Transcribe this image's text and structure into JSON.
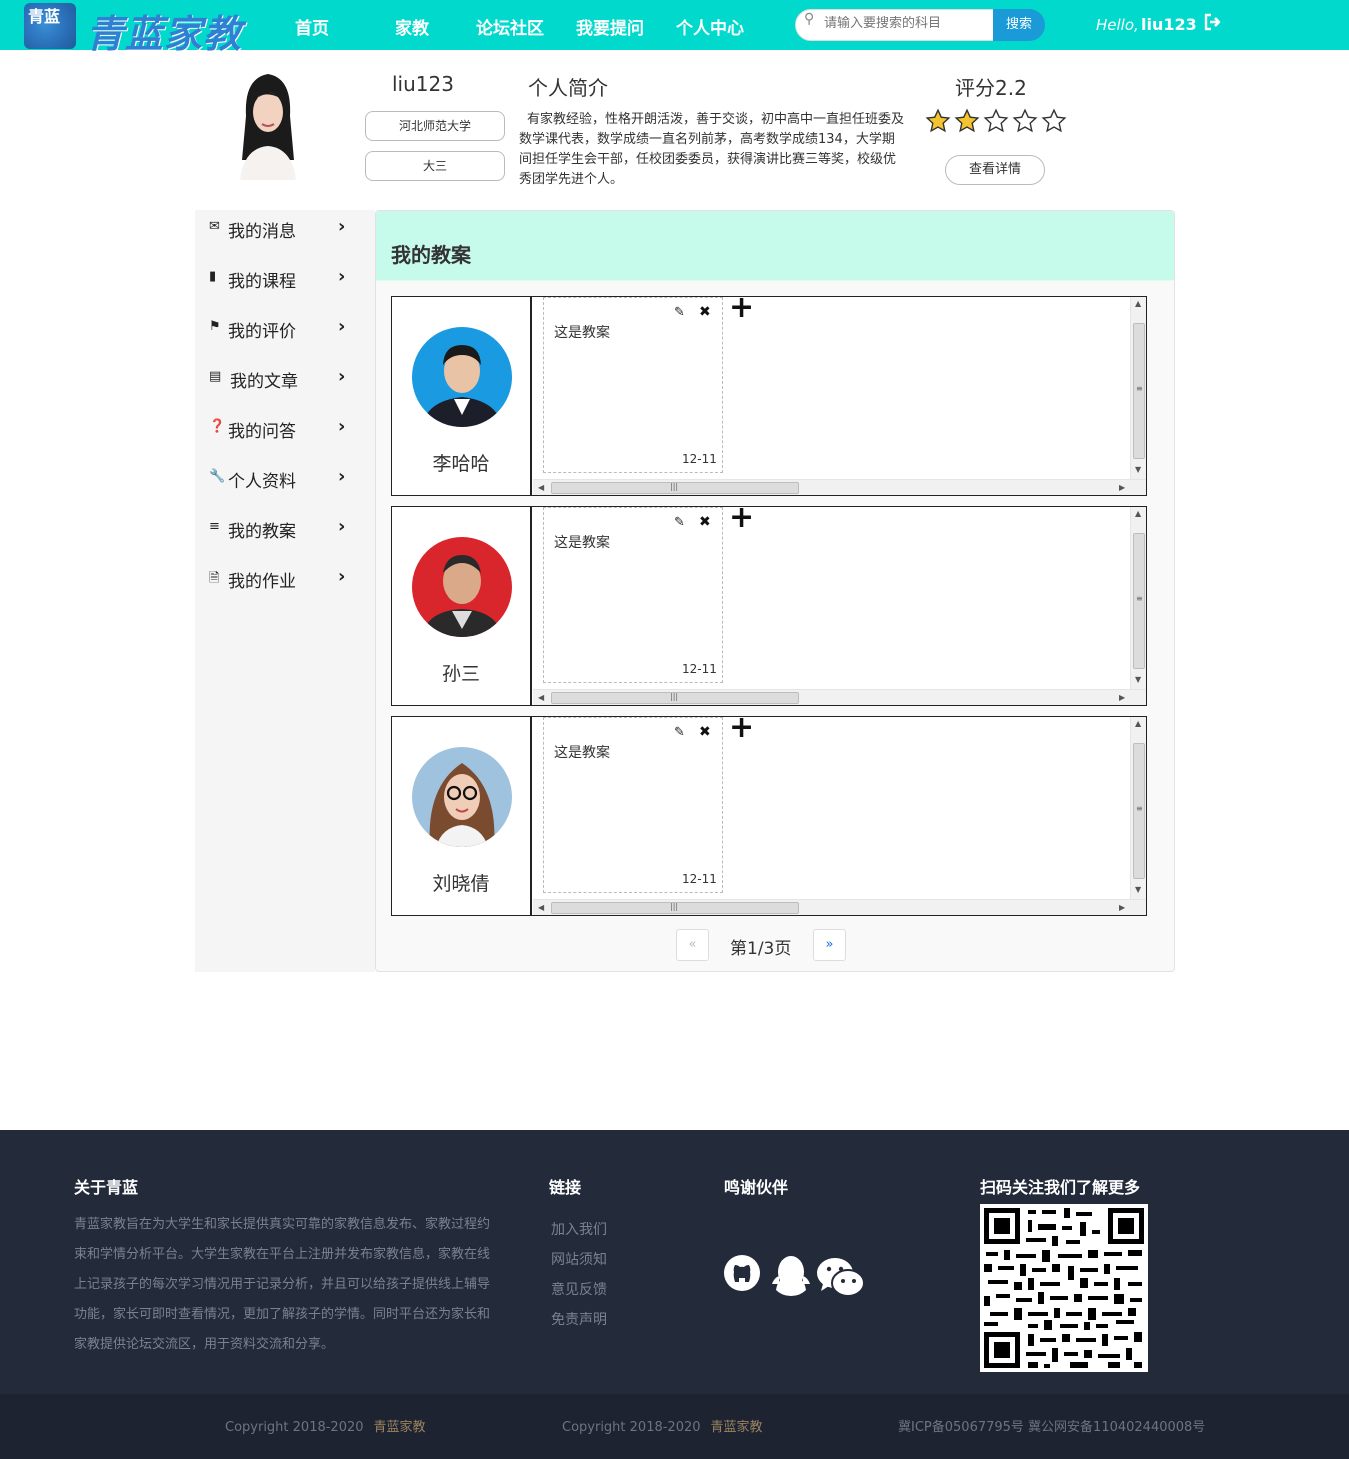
{
  "header": {
    "logo_mark": "青蓝",
    "logo_text": "青蓝家教",
    "nav": [
      "首页",
      "家教",
      "论坛社区",
      "我要提问",
      "个人中心"
    ],
    "search_placeholder": "请输入要搜索的科目",
    "search_button": "搜索",
    "hello": "Hello,",
    "username": "liu123"
  },
  "profile": {
    "name": "liu123",
    "school": "河北师范大学",
    "grade": "大三",
    "intro_title": "个人简介",
    "intro_text": "有家教经验，性格开朗活泼，善于交谈，初中高中一直担任班委及数学课代表，数学成绩一直名列前茅，高考数学成绩134，大学期间担任学生会干部，任校团委委员，获得演讲比赛三等奖，校级优秀团学先进个人。",
    "score_label": "评分2.2",
    "rating_filled": 2,
    "rating_max": 5,
    "detail_button": "查看详情"
  },
  "sidebar": {
    "items": [
      {
        "label": "我的消息",
        "icon": "envelope-icon"
      },
      {
        "label": "我的课程",
        "icon": "book-icon"
      },
      {
        "label": "我的评价",
        "icon": "flag-icon"
      },
      {
        "label": "我的文章",
        "icon": "newspaper-icon"
      },
      {
        "label": "我的问答",
        "icon": "question-circle-icon"
      },
      {
        "label": "个人资料",
        "icon": "wrench-icon"
      },
      {
        "label": "我的教案",
        "icon": "layers-icon"
      },
      {
        "label": "我的作业",
        "icon": "file-icon"
      }
    ]
  },
  "main": {
    "title": "我的教案",
    "students": [
      {
        "name": "李哈哈",
        "plan_text": "这是教案",
        "date": "12-11",
        "avatar_bg": "#1a9ae0"
      },
      {
        "name": "孙三",
        "plan_text": "这是教案",
        "date": "12-11",
        "avatar_bg": "#d9262c"
      },
      {
        "name": "刘晓倩",
        "plan_text": "这是教案",
        "date": "12-11",
        "avatar_bg": "#9fc3de"
      }
    ],
    "pager": {
      "prev": "«",
      "text": "第1/3页",
      "next": "»"
    }
  },
  "footer": {
    "about_title": "关于青蓝",
    "about_text": "青蓝家教旨在为大学生和家长提供真实可靠的家教信息发布、家教过程约束和学情分析平台。大学生家教在平台上注册并发布家教信息，家教在线上记录孩子的每次学习情况用于记录分析，并且可以给孩子提供线上辅导功能，家长可即时查看情况，更加了解孩子的学情。同时平台还为家长和家教提供论坛交流区，用于资料交流和分享。",
    "links_title": "链接",
    "links": [
      "加入我们",
      "网站须知",
      "意见反馈",
      "免责声明"
    ],
    "partners_title": "鸣谢伙伴",
    "partners": [
      "github-icon",
      "qq-icon",
      "wechat-icon"
    ],
    "qr_title": "扫码关注我们了解更多",
    "copyright1": "Copyright 2018-2020",
    "brand1": "青蓝家教",
    "copyright2": "Copyright 2018-2020",
    "brand2": "青蓝家教",
    "icp": "冀ICP备05067795号 冀公网安备110402440008号"
  }
}
